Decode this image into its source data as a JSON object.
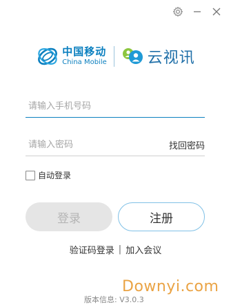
{
  "window": {
    "controls": [
      {
        "name": "settings",
        "icon": "gear-icon"
      },
      {
        "name": "minimize",
        "icon": "minimize-icon"
      },
      {
        "name": "close",
        "icon": "close-icon"
      }
    ]
  },
  "branding": {
    "carrier_name_cn": "中国移动",
    "carrier_name_en": "China Mobile",
    "app_name": "云视讯",
    "brand_color": "#0a7fbf"
  },
  "form": {
    "phone_placeholder": "请输入手机号码",
    "phone_value": "",
    "password_placeholder": "请输入密码",
    "password_value": "",
    "forgot_password": "找回密码",
    "auto_login_label": "自动登录",
    "auto_login_checked": false
  },
  "buttons": {
    "login": "登录",
    "register": "注册"
  },
  "links": {
    "code_login": "验证码登录",
    "separator": "|",
    "join_meeting": "加入会议"
  },
  "footer": {
    "version": "版本信息: V3.0.3"
  },
  "watermark": "Downyi.com"
}
